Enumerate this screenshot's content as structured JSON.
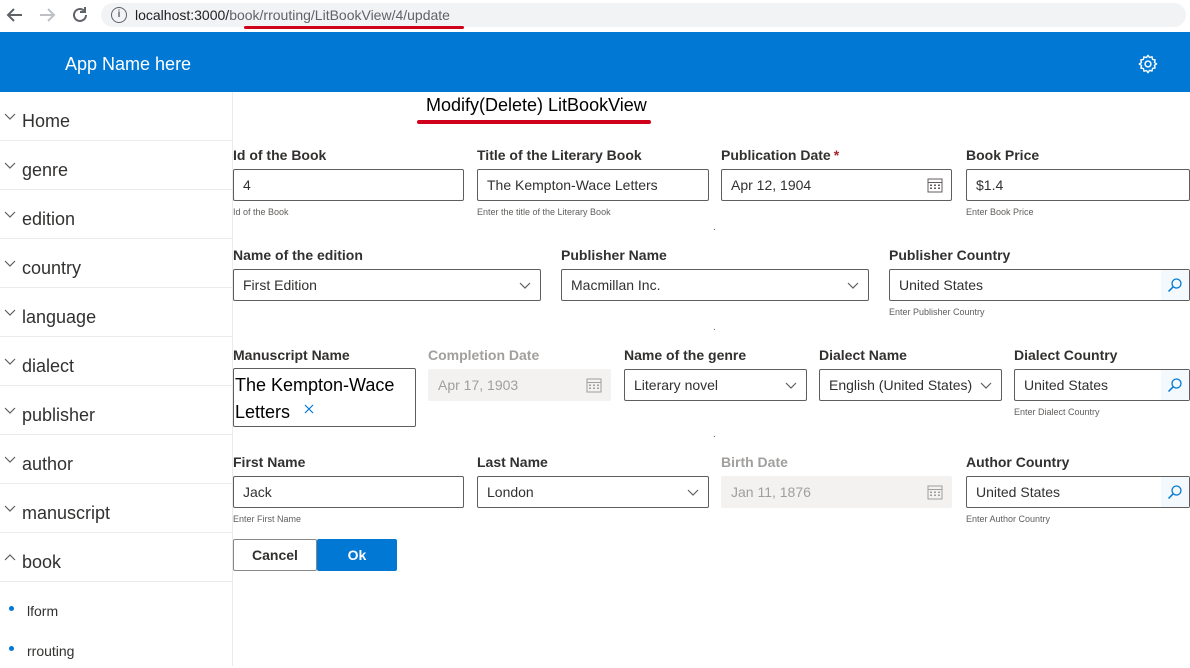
{
  "browser": {
    "url_host": "localhost:3000/",
    "url_path": "book/rrouting/LitBookView/4/update"
  },
  "app": {
    "name": "App Name here"
  },
  "sidebar": {
    "items": [
      {
        "label": "Home"
      },
      {
        "label": "genre"
      },
      {
        "label": "edition"
      },
      {
        "label": "country"
      },
      {
        "label": "language"
      },
      {
        "label": "dialect"
      },
      {
        "label": "publisher"
      },
      {
        "label": "author"
      },
      {
        "label": "manuscript"
      },
      {
        "label": "book"
      }
    ],
    "subitems": [
      {
        "label": "lform"
      },
      {
        "label": "rrouting"
      }
    ]
  },
  "form": {
    "title": "Modify(Delete) LitBookView",
    "book_id": {
      "label": "Id of the Book",
      "value": "4",
      "hint": "Id of the Book"
    },
    "book_title": {
      "label": "Title of the Literary Book",
      "value": "The Kempton-Wace Letters",
      "hint": "Enter the title of the Literary Book"
    },
    "publication_date": {
      "label": "Publication Date",
      "required_mark": "*",
      "value": "Apr 12, 1904"
    },
    "book_price": {
      "label": "Book Price",
      "value": "$1.4",
      "hint": "Enter Book Price"
    },
    "edition_name": {
      "label": "Name of the edition",
      "value": "First Edition"
    },
    "publisher_name": {
      "label": "Publisher Name",
      "value": "Macmillan Inc."
    },
    "publisher_country": {
      "label": "Publisher Country",
      "value": "United States",
      "hint": "Enter Publisher Country"
    },
    "manuscript_name": {
      "label": "Manuscript Name",
      "value": "The Kempton-Wace Letters"
    },
    "completion_date": {
      "label": "Completion Date",
      "value": "Apr 17, 1903"
    },
    "genre_name": {
      "label": "Name of the genre",
      "value": "Literary novel"
    },
    "dialect_name": {
      "label": "Dialect Name",
      "value": "English (United States)"
    },
    "dialect_country": {
      "label": "Dialect Country",
      "value": "United States",
      "hint": "Enter Dialect Country"
    },
    "first_name": {
      "label": "First Name",
      "value": "Jack",
      "hint": "Enter First Name"
    },
    "last_name": {
      "label": "Last Name",
      "value": "London"
    },
    "birth_date": {
      "label": "Birth Date",
      "value": "Jan 11, 1876"
    },
    "author_country": {
      "label": "Author Country",
      "value": "United States",
      "hint": "Enter Author Country"
    },
    "cancel_label": "Cancel",
    "ok_label": "Ok"
  },
  "colors": {
    "accent": "#0078d4",
    "annotation": "#d0021b"
  },
  "icons": [
    "back-icon",
    "forward-icon",
    "reload-icon",
    "info-icon",
    "gear-icon",
    "chevron-down-icon",
    "chevron-up-icon",
    "calendar-icon",
    "search-icon",
    "clear-icon"
  ]
}
